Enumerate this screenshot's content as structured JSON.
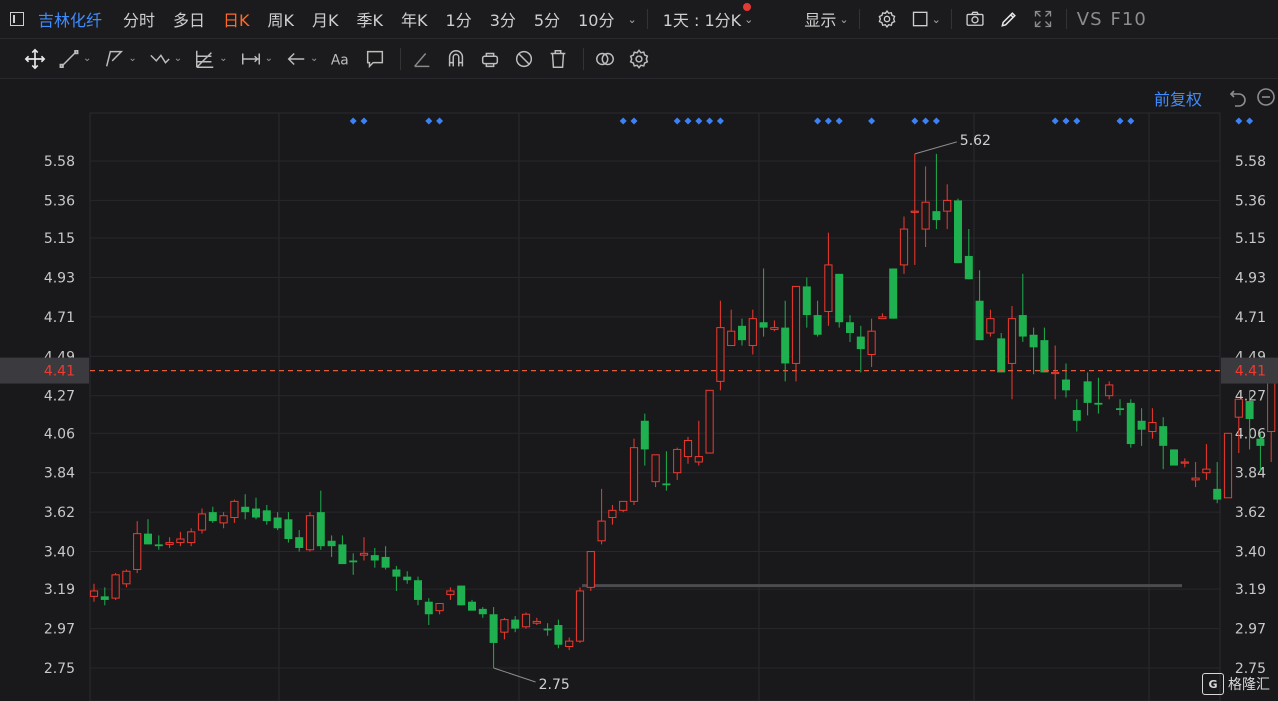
{
  "stock": {
    "name": "吉林化纤"
  },
  "periods": [
    "分时",
    "多日",
    "日K",
    "周K",
    "月K",
    "季K",
    "年K",
    "1分",
    "3分",
    "5分",
    "10分"
  ],
  "active_period": "日K",
  "interval_select": "1天 : 1分K",
  "display_label": "显示",
  "vs_label": "VS",
  "f10_label": "F10",
  "adjust_label": "前复权",
  "colors": {
    "up": "#f0392f",
    "down": "#1fb050",
    "accent": "#3f8cff",
    "active": "#ff6a28",
    "current_line": "#e35b3a",
    "marker": "#3b82f6"
  },
  "watermark": "格隆汇",
  "chart_data": {
    "type": "candlestick",
    "y_ticks": [
      "5.58",
      "5.36",
      "5.15",
      "4.93",
      "4.71",
      "4.49",
      "4.27",
      "4.06",
      "3.84",
      "3.62",
      "3.40",
      "3.19",
      "2.97",
      "2.75"
    ],
    "ylim": [
      2.75,
      5.58
    ],
    "current_price": "4.41",
    "max_label": "5.62",
    "min_label": "2.75",
    "support_level": 3.21,
    "marker_groups": [
      [
        24,
        25
      ],
      [
        31,
        32
      ],
      [
        49,
        50
      ],
      [
        54,
        55,
        56,
        57,
        58
      ],
      [
        67,
        68,
        69
      ],
      [
        72
      ],
      [
        76,
        77,
        78
      ],
      [
        89,
        90,
        91
      ],
      [
        95,
        96
      ],
      [
        106,
        107
      ],
      [
        111,
        112
      ]
    ],
    "candles": [
      [
        3.15,
        3.22,
        3.12,
        3.18
      ],
      [
        3.15,
        3.2,
        3.1,
        3.13
      ],
      [
        3.14,
        3.28,
        3.13,
        3.27
      ],
      [
        3.22,
        3.3,
        3.2,
        3.29
      ],
      [
        3.3,
        3.57,
        3.28,
        3.5
      ],
      [
        3.5,
        3.58,
        3.44,
        3.44
      ],
      [
        3.44,
        3.49,
        3.41,
        3.43
      ],
      [
        3.44,
        3.48,
        3.42,
        3.45
      ],
      [
        3.45,
        3.51,
        3.43,
        3.47
      ],
      [
        3.45,
        3.53,
        3.43,
        3.51
      ],
      [
        3.52,
        3.64,
        3.5,
        3.61
      ],
      [
        3.62,
        3.65,
        3.56,
        3.57
      ],
      [
        3.56,
        3.62,
        3.53,
        3.6
      ],
      [
        3.59,
        3.69,
        3.56,
        3.68
      ],
      [
        3.65,
        3.72,
        3.58,
        3.62
      ],
      [
        3.64,
        3.7,
        3.58,
        3.59
      ],
      [
        3.63,
        3.66,
        3.55,
        3.57
      ],
      [
        3.59,
        3.62,
        3.52,
        3.53
      ],
      [
        3.58,
        3.62,
        3.45,
        3.47
      ],
      [
        3.48,
        3.52,
        3.4,
        3.42
      ],
      [
        3.41,
        3.62,
        3.4,
        3.6
      ],
      [
        3.62,
        3.74,
        3.41,
        3.43
      ],
      [
        3.46,
        3.49,
        3.37,
        3.43
      ],
      [
        3.44,
        3.49,
        3.34,
        3.33
      ],
      [
        3.35,
        3.39,
        3.27,
        3.34
      ],
      [
        3.38,
        3.48,
        3.35,
        3.39
      ],
      [
        3.38,
        3.42,
        3.31,
        3.35
      ],
      [
        3.37,
        3.43,
        3.3,
        3.31
      ],
      [
        3.3,
        3.32,
        3.18,
        3.26
      ],
      [
        3.26,
        3.29,
        3.22,
        3.24
      ],
      [
        3.24,
        3.26,
        3.1,
        3.13
      ],
      [
        3.12,
        3.14,
        2.99,
        3.05
      ],
      [
        3.07,
        3.11,
        3.05,
        3.11
      ],
      [
        3.16,
        3.2,
        3.13,
        3.18
      ],
      [
        3.21,
        3.21,
        3.1,
        3.1
      ],
      [
        3.12,
        3.13,
        3.08,
        3.07
      ],
      [
        3.08,
        3.09,
        3.03,
        3.05
      ],
      [
        3.05,
        3.09,
        2.75,
        2.89
      ],
      [
        2.95,
        3.03,
        2.91,
        3.02
      ],
      [
        3.02,
        3.04,
        2.95,
        2.97
      ],
      [
        2.98,
        3.06,
        2.97,
        3.05
      ],
      [
        3.0,
        3.03,
        2.99,
        3.01
      ],
      [
        2.97,
        3.0,
        2.93,
        2.96
      ],
      [
        2.99,
        3.02,
        2.86,
        2.88
      ],
      [
        2.87,
        2.92,
        2.85,
        2.9
      ],
      [
        2.9,
        3.2,
        2.89,
        3.18
      ],
      [
        3.2,
        3.4,
        3.18,
        3.4
      ],
      [
        3.46,
        3.75,
        3.44,
        3.57
      ],
      [
        3.59,
        3.66,
        3.55,
        3.63
      ],
      [
        3.63,
        3.67,
        3.62,
        3.68
      ],
      [
        3.68,
        4.03,
        3.66,
        3.98
      ],
      [
        4.13,
        4.17,
        3.88,
        3.97
      ],
      [
        3.79,
        3.82,
        3.76,
        3.94
      ],
      [
        3.78,
        3.96,
        3.74,
        3.77
      ],
      [
        3.84,
        3.98,
        3.8,
        3.97
      ],
      [
        3.93,
        4.04,
        3.89,
        4.02
      ],
      [
        3.9,
        4.13,
        3.88,
        3.93
      ],
      [
        3.95,
        4.3,
        3.95,
        4.3
      ],
      [
        4.35,
        4.8,
        4.3,
        4.65
      ],
      [
        4.55,
        4.75,
        4.55,
        4.63
      ],
      [
        4.66,
        4.7,
        4.55,
        4.58
      ],
      [
        4.55,
        4.75,
        4.5,
        4.7
      ],
      [
        4.68,
        4.98,
        4.6,
        4.65
      ],
      [
        4.64,
        4.69,
        4.63,
        4.65
      ],
      [
        4.65,
        4.8,
        4.35,
        4.45
      ],
      [
        4.45,
        4.88,
        4.35,
        4.88
      ],
      [
        4.88,
        4.93,
        4.65,
        4.72
      ],
      [
        4.72,
        4.8,
        4.6,
        4.61
      ],
      [
        4.74,
        5.18,
        4.66,
        5.0
      ],
      [
        4.95,
        4.95,
        4.65,
        4.68
      ],
      [
        4.68,
        4.72,
        4.57,
        4.62
      ],
      [
        4.6,
        4.66,
        4.4,
        4.53
      ],
      [
        4.5,
        4.7,
        4.43,
        4.63
      ],
      [
        4.7,
        4.73,
        4.7,
        4.71
      ],
      [
        4.98,
        4.98,
        4.7,
        4.7
      ],
      [
        5.0,
        5.27,
        4.95,
        5.2
      ],
      [
        5.3,
        5.62,
        5.0,
        5.3
      ],
      [
        5.2,
        5.55,
        5.1,
        5.35
      ],
      [
        5.3,
        5.62,
        5.2,
        5.25
      ],
      [
        5.3,
        5.45,
        5.2,
        5.36
      ],
      [
        5.36,
        5.37,
        5.01,
        5.01
      ],
      [
        5.05,
        5.2,
        4.92,
        4.92
      ],
      [
        4.8,
        4.97,
        4.58,
        4.58
      ],
      [
        4.62,
        4.75,
        4.6,
        4.7
      ],
      [
        4.59,
        4.62,
        4.4,
        4.4
      ],
      [
        4.45,
        4.77,
        4.25,
        4.7
      ],
      [
        4.72,
        4.95,
        4.57,
        4.6
      ],
      [
        4.61,
        4.65,
        4.39,
        4.54
      ],
      [
        4.58,
        4.65,
        4.4,
        4.4
      ],
      [
        4.4,
        4.55,
        4.25,
        4.4
      ],
      [
        4.36,
        4.45,
        4.26,
        4.3
      ],
      [
        4.19,
        4.25,
        4.07,
        4.13
      ],
      [
        4.35,
        4.4,
        4.16,
        4.23
      ],
      [
        4.23,
        4.37,
        4.17,
        4.22
      ],
      [
        4.27,
        4.35,
        4.25,
        4.33
      ],
      [
        4.2,
        4.25,
        4.16,
        4.19
      ],
      [
        4.23,
        4.25,
        3.98,
        4.0
      ],
      [
        4.13,
        4.2,
        3.99,
        4.08
      ],
      [
        4.07,
        4.2,
        4.03,
        4.12
      ],
      [
        4.1,
        4.15,
        3.86,
        3.99
      ],
      [
        3.97,
        3.97,
        3.89,
        3.88
      ],
      [
        3.9,
        3.92,
        3.87,
        3.9
      ],
      [
        3.8,
        3.9,
        3.76,
        3.81
      ],
      [
        3.84,
        4.0,
        3.8,
        3.86
      ],
      [
        3.75,
        3.9,
        3.67,
        3.69
      ],
      [
        3.7,
        4.05,
        3.7,
        4.06
      ],
      [
        4.15,
        4.25,
        3.95,
        4.25
      ],
      [
        4.24,
        4.3,
        3.97,
        4.14
      ],
      [
        4.03,
        4.06,
        3.85,
        3.99
      ],
      [
        4.07,
        4.41,
        3.9,
        4.41
      ]
    ]
  }
}
